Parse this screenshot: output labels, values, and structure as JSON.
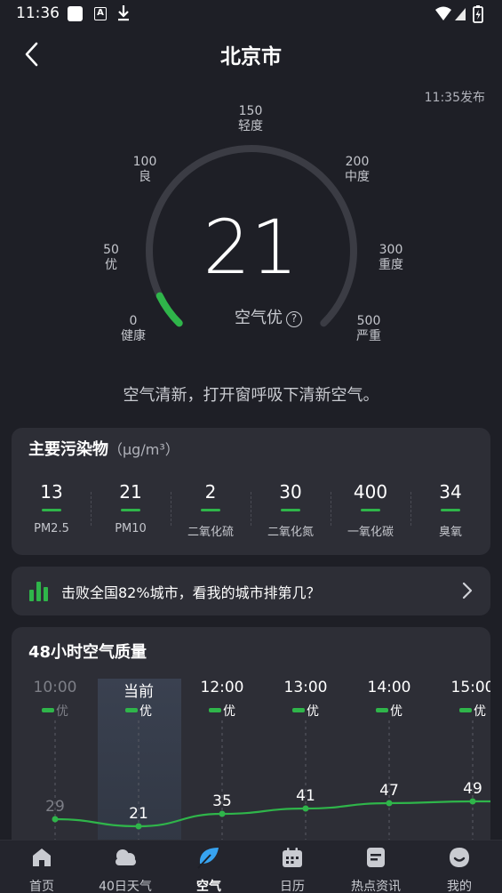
{
  "status_bar": {
    "time": "11:36",
    "a_icon": "A"
  },
  "header": {
    "title": "北京市",
    "publish_time": "11:35发布"
  },
  "gauge": {
    "aqi": "21",
    "level": "空气优",
    "help": "?",
    "aqi_max": 500,
    "ticks": [
      {
        "value": "0",
        "label": "健康"
      },
      {
        "value": "50",
        "label": "优"
      },
      {
        "value": "100",
        "label": "良"
      },
      {
        "value": "150",
        "label": "轻度"
      },
      {
        "value": "200",
        "label": "中度"
      },
      {
        "value": "300",
        "label": "重度"
      },
      {
        "value": "500",
        "label": "严重"
      }
    ],
    "accent_color": "#2fb54a",
    "track_color": "#3b3c44"
  },
  "advice": "空气清新，打开窗呼吸下清新空气。",
  "pollutants": {
    "title": "主要污染物",
    "unit": "（μg/m³）",
    "items": [
      {
        "value": "13",
        "name": "PM2.5"
      },
      {
        "value": "21",
        "name": "PM10"
      },
      {
        "value": "2",
        "name": "二氧化硫"
      },
      {
        "value": "30",
        "name": "二氧化氮"
      },
      {
        "value": "400",
        "name": "一氧化碳"
      },
      {
        "value": "34",
        "name": "臭氧"
      }
    ]
  },
  "ranking": {
    "text": "击败全国82%城市，看我的城市排第几？"
  },
  "hourly": {
    "title": "48小时空气质量",
    "hours": [
      {
        "time": "10:00",
        "level": "优",
        "aqi": "29"
      },
      {
        "time": "当前",
        "level": "优",
        "aqi": "21"
      },
      {
        "time": "12:00",
        "level": "优",
        "aqi": "35"
      },
      {
        "time": "13:00",
        "level": "优",
        "aqi": "41"
      },
      {
        "time": "14:00",
        "level": "优",
        "aqi": "47"
      },
      {
        "time": "15:00",
        "level": "优",
        "aqi": "49"
      }
    ]
  },
  "bottom_nav": {
    "items": [
      {
        "label": "首页",
        "icon": "home-icon"
      },
      {
        "label": "40日天气",
        "icon": "cloud-icon"
      },
      {
        "label": "空气",
        "icon": "leaf-icon"
      },
      {
        "label": "日历",
        "icon": "calendar-icon"
      },
      {
        "label": "热点资讯",
        "icon": "news-icon"
      },
      {
        "label": "我的",
        "icon": "profile-icon"
      }
    ],
    "active_index": 2
  }
}
